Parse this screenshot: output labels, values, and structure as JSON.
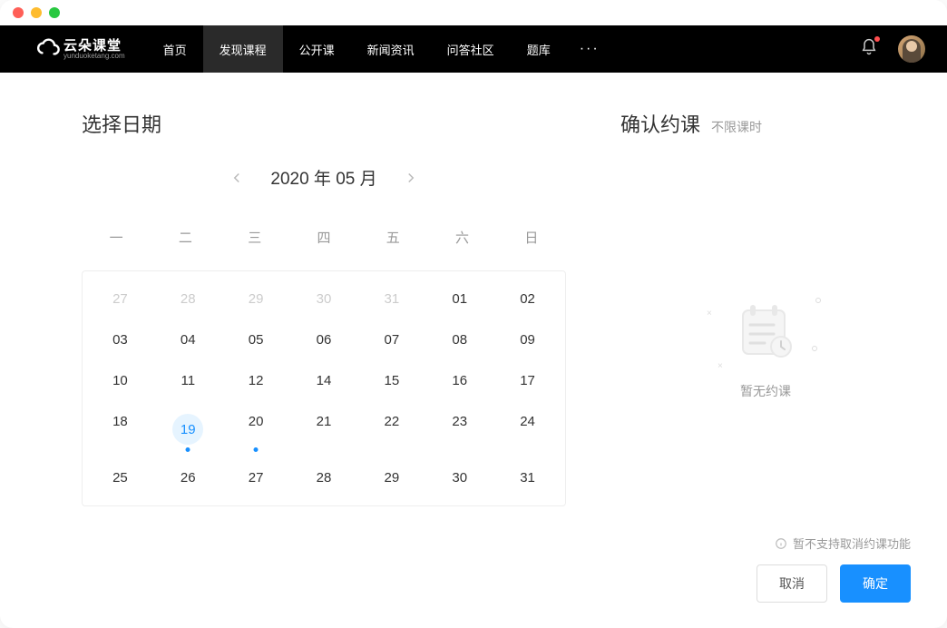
{
  "logo": {
    "main": "云朵课堂",
    "sub": "yunduoketang.com"
  },
  "nav": {
    "items": [
      {
        "label": "首页",
        "active": false
      },
      {
        "label": "发现课程",
        "active": true
      },
      {
        "label": "公开课",
        "active": false
      },
      {
        "label": "新闻资讯",
        "active": false
      },
      {
        "label": "问答社区",
        "active": false
      },
      {
        "label": "题库",
        "active": false
      }
    ],
    "more": "···"
  },
  "left": {
    "title": "选择日期",
    "month_label": "2020 年 05 月",
    "weekdays": [
      "一",
      "二",
      "三",
      "四",
      "五",
      "六",
      "日"
    ],
    "days": [
      {
        "n": "27",
        "other": true
      },
      {
        "n": "28",
        "other": true
      },
      {
        "n": "29",
        "other": true
      },
      {
        "n": "30",
        "other": true
      },
      {
        "n": "31",
        "other": true
      },
      {
        "n": "01"
      },
      {
        "n": "02"
      },
      {
        "n": "03"
      },
      {
        "n": "04"
      },
      {
        "n": "05"
      },
      {
        "n": "06"
      },
      {
        "n": "07"
      },
      {
        "n": "08"
      },
      {
        "n": "09"
      },
      {
        "n": "10"
      },
      {
        "n": "11"
      },
      {
        "n": "12"
      },
      {
        "n": "14"
      },
      {
        "n": "15"
      },
      {
        "n": "16"
      },
      {
        "n": "17"
      },
      {
        "n": "18"
      },
      {
        "n": "19",
        "selected": true,
        "dot": true
      },
      {
        "n": "20",
        "dot": true
      },
      {
        "n": "21"
      },
      {
        "n": "22"
      },
      {
        "n": "23"
      },
      {
        "n": "24"
      },
      {
        "n": "25"
      },
      {
        "n": "26"
      },
      {
        "n": "27"
      },
      {
        "n": "28"
      },
      {
        "n": "29"
      },
      {
        "n": "30"
      },
      {
        "n": "31"
      }
    ]
  },
  "right": {
    "title": "确认约课",
    "subtitle": "不限课时",
    "empty_text": "暂无约课",
    "note": "暂不支持取消约课功能",
    "cancel": "取消",
    "confirm": "确定"
  }
}
